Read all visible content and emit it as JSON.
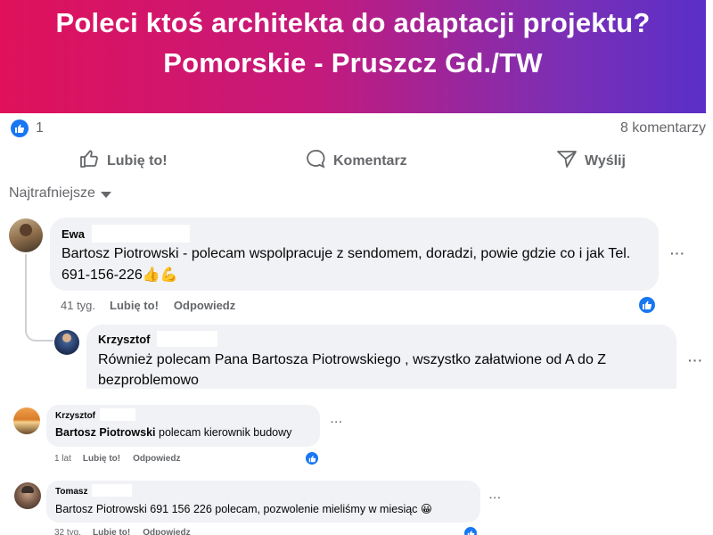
{
  "header": {
    "line1": "Poleci ktoś architekta do adaptacji projektu?",
    "line2": "Pomorskie - Pruszcz Gd./TW"
  },
  "stats": {
    "likes": "1",
    "comments": "8 komentarzy"
  },
  "actions": {
    "like": "Lubię to!",
    "comment": "Komentarz",
    "send": "Wyślij"
  },
  "sort": {
    "label": "Najtrafniejsze"
  },
  "comments": [
    {
      "author": "Ewa",
      "text": "Bartosz Piotrowski - polecam wspolpracuje z sendomem, doradzi, powie gdzie co i jak Tel. 691-156-226👍💪",
      "time": "41 tyg.",
      "like": "Lubię to!",
      "reply": "Odpowiedz",
      "more": "···"
    },
    {
      "author": "Krzysztof",
      "text": "Również polecam Pana Bartosza Piotrowskiego , wszystko załatwione od A do Z bezproblemowo",
      "more": "···"
    },
    {
      "author": "Krzysztof",
      "text_bold": "Bartosz Piotrowski",
      "text": " polecam kierownik budowy",
      "time": "1 lat",
      "like": "Lubię to!",
      "reply": "Odpowiedz",
      "more": "···"
    },
    {
      "author": "Tomasz",
      "text": "Bartosz Piotrowski 691 156 226 polecam, pozwolenie mieliśmy w miesiąc 😀",
      "time": "32 tyg.",
      "like": "Lubię to!",
      "reply": "Odpowiedz",
      "more": "···"
    }
  ],
  "colors": {
    "accent": "#1877f2",
    "bubble": "#f0f2f5",
    "muted": "#65676b"
  }
}
